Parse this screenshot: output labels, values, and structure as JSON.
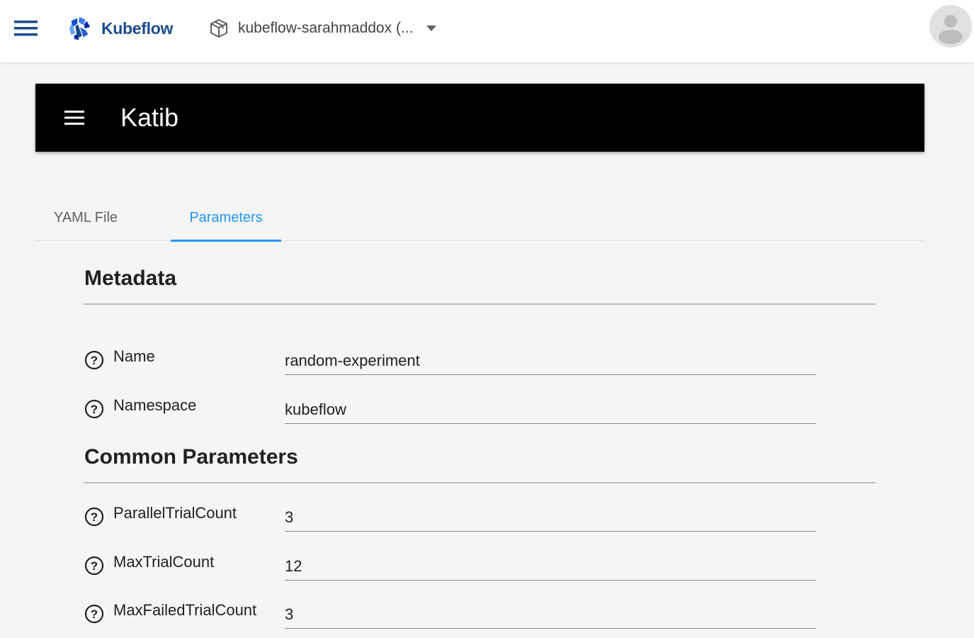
{
  "topbar": {
    "menu_icon": "hamburger-menu-icon",
    "brand_icon": "kubeflow-logo-icon",
    "brand_name": "Kubeflow",
    "namespace_icon": "namespace-cube-icon",
    "namespace": "kubeflow-sarahmaddox (...",
    "namespace_dropdown_icon": "caret-down-icon",
    "avatar_icon": "user-avatar-icon"
  },
  "katib": {
    "menu_icon": "hamburger-menu-icon",
    "title": "Katib"
  },
  "tabs": [
    {
      "label": "YAML File",
      "active": false
    },
    {
      "label": "Parameters",
      "active": true
    }
  ],
  "sections": {
    "metadata": {
      "title": "Metadata",
      "fields": [
        {
          "label": "Name",
          "value": "random-experiment",
          "icon": "help-icon"
        },
        {
          "label": "Namespace",
          "value": "kubeflow",
          "icon": "help-icon"
        }
      ]
    },
    "common": {
      "title": "Common Parameters",
      "fields": [
        {
          "label": "ParallelTrialCount",
          "value": "3",
          "icon": "help-icon"
        },
        {
          "label": "MaxTrialCount",
          "value": "12",
          "icon": "help-icon"
        },
        {
          "label": "MaxFailedTrialCount",
          "value": "3",
          "icon": "help-icon"
        }
      ]
    }
  },
  "colors": {
    "brand": "#1b4b8c",
    "accent": "#2196f3",
    "katib_bar": "#000000",
    "page_bg": "#f5f5f5"
  }
}
